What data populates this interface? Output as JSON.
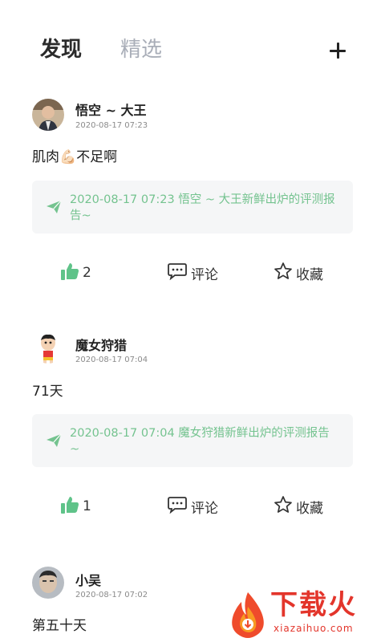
{
  "tabs": {
    "active": "发现",
    "inactive": "精选"
  },
  "add_icon": "plus-icon",
  "colors": {
    "accent": "#5fc389",
    "share_text": "#74c38f",
    "card_bg": "#f5f6f7",
    "watermark": "#e3352b"
  },
  "posts": [
    {
      "user": "悟空 ~ 大王",
      "time": "2020-08-17 07:23",
      "text": "肌肉💪🏻不足啊",
      "share": "2020-08-17 07:23 悟空 ~ 大王新鲜出炉的评测报告~",
      "likes": "2",
      "comment_label": "评论",
      "fav_label": "收藏"
    },
    {
      "user": "魔女狩猎",
      "time": "2020-08-17 07:04",
      "text": "71天",
      "share": "2020-08-17 07:04 魔女狩猎新鲜出炉的评测报告~",
      "likes": "1",
      "comment_label": "评论",
      "fav_label": "收藏"
    },
    {
      "user": "小吴",
      "time": "2020-08-17 07:02",
      "text": "第五十天"
    }
  ],
  "watermark": {
    "title": "下载火",
    "subtitle": "xiazaihuo.com"
  }
}
